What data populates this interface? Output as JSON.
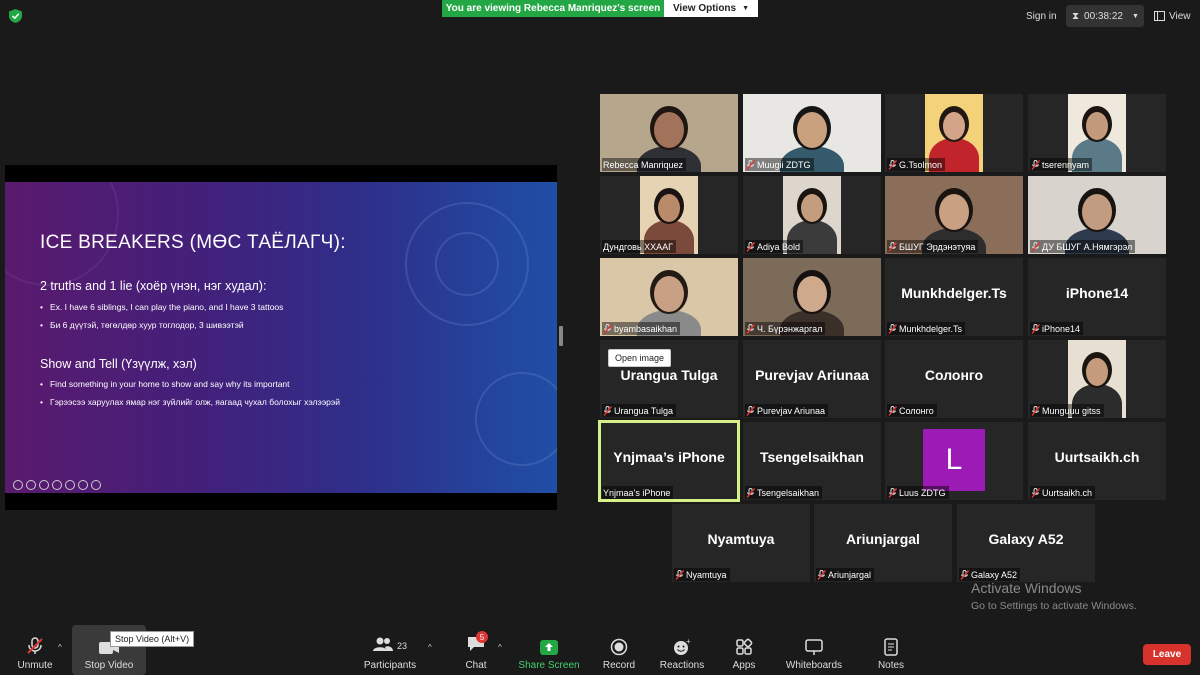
{
  "top_bar": {
    "banner_text": "You are viewing Rebecca Manriquez's screen",
    "view_options_label": "View Options",
    "sign_in_label": "Sign in",
    "timer": "00:38:22",
    "view_label": "View"
  },
  "slide": {
    "title": "ICE BREAKERS (МӨС ТАЁЛАГЧ):",
    "section1_heading": "2 truths and 1 lie (хоёр үнэн, нэг худал):",
    "section1_bullets": [
      "Ex. I have 6 siblings, I can play the piano, and I have 3 tattoos",
      "Би 6 дүүтэй, төгөлдөр хуур тоглодор, 3 шивээтэй"
    ],
    "section2_heading": "Show and Tell (Үзүүлж, хэл)",
    "section2_bullets": [
      "Find something in your home to show and say why its important",
      "Гэрээсээ харуулах ямар нэг зүйлийг олж, яагаад чухал болохыг хэлээрэй"
    ]
  },
  "participants": [
    {
      "name": "Rebecca Manriquez",
      "muted": false,
      "video": true
    },
    {
      "name": "Muugii ZDTG",
      "muted": true,
      "video": true
    },
    {
      "name": "G.Tsolmon",
      "muted": true,
      "video": true
    },
    {
      "name": "tserennyam",
      "muted": true,
      "video": true
    },
    {
      "name": "Дундговь ХХААГ",
      "muted": false,
      "video": true
    },
    {
      "name": "Adiya Bold",
      "muted": true,
      "video": true
    },
    {
      "name": "БШУГ Эрдэнэтуяа",
      "muted": true,
      "video": true
    },
    {
      "name": "ДУ БШУГ А.Нямгэрэл",
      "muted": true,
      "video": true
    },
    {
      "name": "byambasaikhan",
      "muted": true,
      "video": true
    },
    {
      "name": "Ч. Бүрэнжаргал",
      "muted": true,
      "video": true
    },
    {
      "name": "Munkhdelger.Ts",
      "muted": true,
      "video": false
    },
    {
      "name": "iPhone14",
      "muted": true,
      "video": false
    },
    {
      "name": "Urangua Tulga",
      "muted": true,
      "video": false
    },
    {
      "name": "Purevjav Ariunaa",
      "muted": true,
      "video": false
    },
    {
      "name": "Солонго",
      "muted": true,
      "video": false
    },
    {
      "name": "Munguuu gitss",
      "muted": true,
      "video": true
    },
    {
      "name": "Ynjmaa’s iPhone",
      "muted": false,
      "video": false
    },
    {
      "name": "Tsengelsaikhan",
      "muted": true,
      "video": false
    },
    {
      "name": "Luus ZDTG",
      "muted": true,
      "video": false,
      "avatar_letter": "L"
    },
    {
      "name": "Uurtsaikh.ch",
      "muted": true,
      "video": false
    },
    {
      "name": "Nyamtuya",
      "muted": true,
      "video": false
    },
    {
      "name": "Ariunjargal",
      "muted": true,
      "video": false
    },
    {
      "name": "Galaxy A52",
      "muted": true,
      "video": false
    }
  ],
  "tooltips": {
    "open_image": "Open image",
    "stop_video": "Stop Video (Alt+V)"
  },
  "watermark": {
    "line1": "Activate Windows",
    "line2": "Go to Settings to activate Windows."
  },
  "toolbar": {
    "unmute": "Unmute",
    "stop_video": "Stop Video",
    "participants": "Participants",
    "participants_count": "23",
    "chat": "Chat",
    "chat_badge": "5",
    "share_screen": "Share Screen",
    "record": "Record",
    "reactions": "Reactions",
    "apps": "Apps",
    "whiteboards": "Whiteboards",
    "notes": "Notes",
    "leave": "Leave"
  },
  "colors": {
    "banner_green": "#23a745",
    "leave_red": "#d8322c",
    "active_speaker": "#d6f08a",
    "avatar_purple": "#9d1bb5",
    "mute_red": "#e03535"
  }
}
